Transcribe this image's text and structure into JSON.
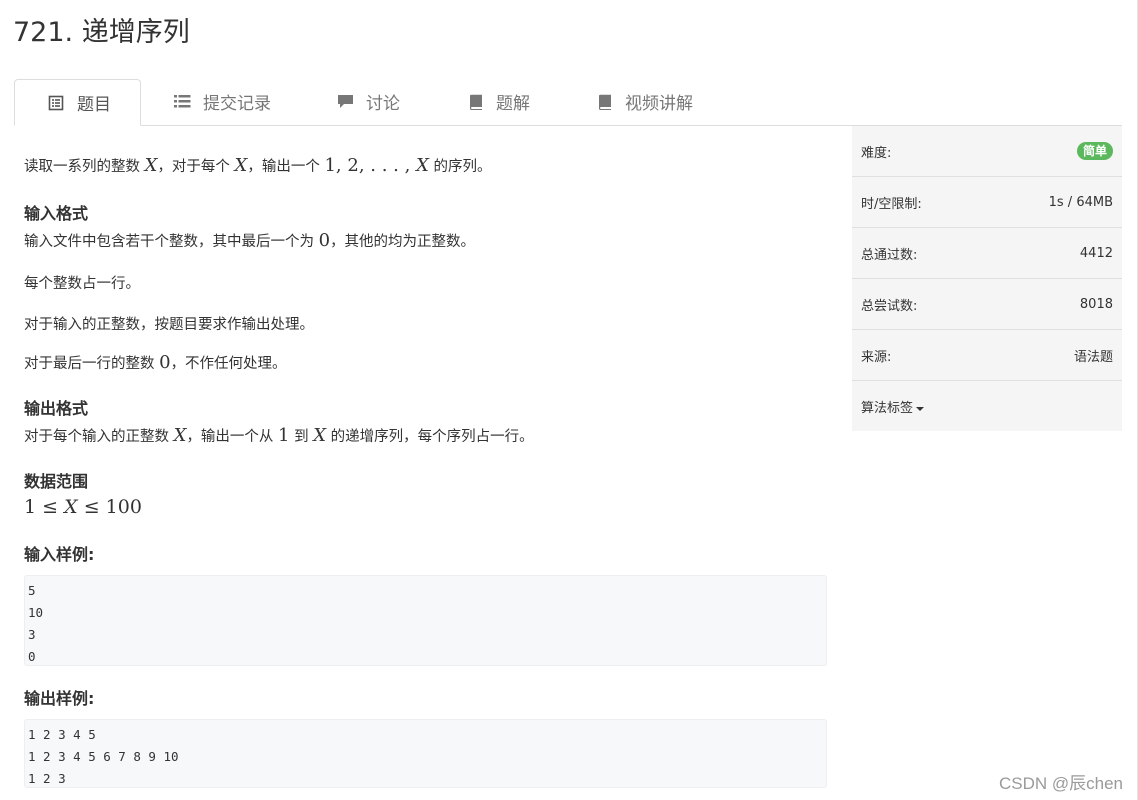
{
  "problem": {
    "title": "721. 递增序列"
  },
  "tabs": [
    {
      "label": "题目",
      "icon": "list-alt-icon",
      "active": true
    },
    {
      "label": "提交记录",
      "icon": "list-icon",
      "active": false
    },
    {
      "label": "讨论",
      "icon": "comment-icon",
      "active": false
    },
    {
      "label": "题解",
      "icon": "book-icon",
      "active": false
    },
    {
      "label": "视频讲解",
      "icon": "book-icon",
      "active": false
    }
  ],
  "description": {
    "intro_a": "读取一系列的整数",
    "intro_b": "，对于每个",
    "intro_c": "，输出一个",
    "intro_d": "的序列。",
    "var_x": "X",
    "seq": "1, 2, . . . ,"
  },
  "input_format": {
    "heading": "输入格式",
    "line1_a": "输入文件中包含若干个整数，其中最后一个为",
    "line1_zero": "0",
    "line1_b": "，其他的均为正整数。",
    "line2": "每个整数占一行。",
    "line3": "对于输入的正整数，按题目要求作输出处理。",
    "line4_a": "对于最后一行的整数",
    "line4_zero": "0",
    "line4_b": "，不作任何处理。"
  },
  "output_format": {
    "heading": "输出格式",
    "line_a": "对于每个输入的正整数",
    "line_b": "，输出一个从",
    "line_one": "1",
    "line_c": "到",
    "line_d": "的递增序列，每个序列占一行。"
  },
  "data_range": {
    "heading": "数据范围",
    "expr_left": "1 ≤",
    "expr_var": "X",
    "expr_right": "≤ 100"
  },
  "sample_input": {
    "heading": "输入样例:",
    "text": "5\n10\n3\n0"
  },
  "sample_output": {
    "heading": "输出样例:",
    "text": "1 2 3 4 5\n1 2 3 4 5 6 7 8 9 10\n1 2 3"
  },
  "sidebar": {
    "difficulty_label": "难度:",
    "difficulty_value": "简单",
    "difficulty_color": "#5cb85c",
    "limits_label": "时/空限制:",
    "limits_value": "1s / 64MB",
    "accepted_label": "总通过数:",
    "accepted_value": "4412",
    "attempts_label": "总尝试数:",
    "attempts_value": "8018",
    "source_label": "来源:",
    "source_value": "语法题",
    "tags_label": "算法标签"
  },
  "watermark": "CSDN @辰chen"
}
